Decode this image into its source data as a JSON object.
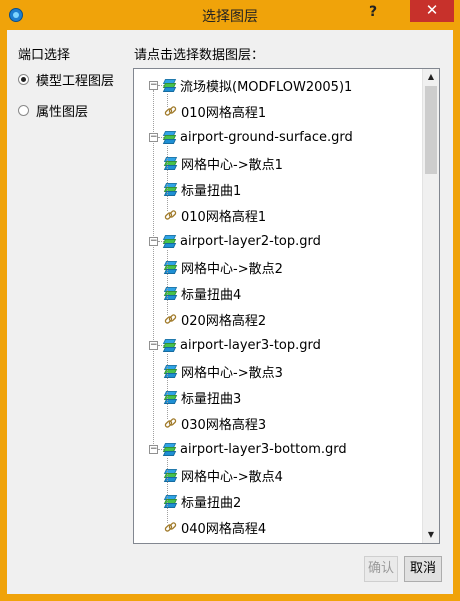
{
  "window": {
    "title": "选择图层",
    "help": "?",
    "close": "✕"
  },
  "left_panel": {
    "label": "端口选择",
    "options": [
      {
        "label": "模型工程图层",
        "selected": true
      },
      {
        "label": "属性图层",
        "selected": false
      }
    ]
  },
  "right_panel": {
    "label": "请点击选择数据图层："
  },
  "tree": {
    "groups": [
      {
        "label": "流场模拟(MODFLOW2005)1",
        "children": [
          {
            "label": "010网格高程1",
            "icon": "link-icon"
          }
        ]
      },
      {
        "label": "airport-ground-surface.grd",
        "children": [
          {
            "label": "网格中心->散点1",
            "icon": "layer-icon"
          },
          {
            "label": "标量扭曲1",
            "icon": "layer-icon"
          },
          {
            "label": "010网格高程1",
            "icon": "link-icon"
          }
        ]
      },
      {
        "label": "airport-layer2-top.grd",
        "children": [
          {
            "label": "网格中心->散点2",
            "icon": "layer-icon"
          },
          {
            "label": "标量扭曲4",
            "icon": "layer-icon"
          },
          {
            "label": "020网格高程2",
            "icon": "link-icon"
          }
        ]
      },
      {
        "label": "airport-layer3-top.grd",
        "children": [
          {
            "label": "网格中心->散点3",
            "icon": "layer-icon"
          },
          {
            "label": "标量扭曲3",
            "icon": "layer-icon"
          },
          {
            "label": "030网格高程3",
            "icon": "link-icon"
          }
        ]
      },
      {
        "label": "airport-layer3-bottom.grd",
        "children": [
          {
            "label": "网格中心->散点4",
            "icon": "layer-icon"
          },
          {
            "label": "标量扭曲2",
            "icon": "layer-icon"
          },
          {
            "label": "040网格高程4",
            "icon": "link-icon"
          }
        ]
      }
    ]
  },
  "buttons": {
    "confirm": "确认",
    "cancel": "取消"
  },
  "colors": {
    "frame": "#f0a30a",
    "close": "#c7312b"
  }
}
